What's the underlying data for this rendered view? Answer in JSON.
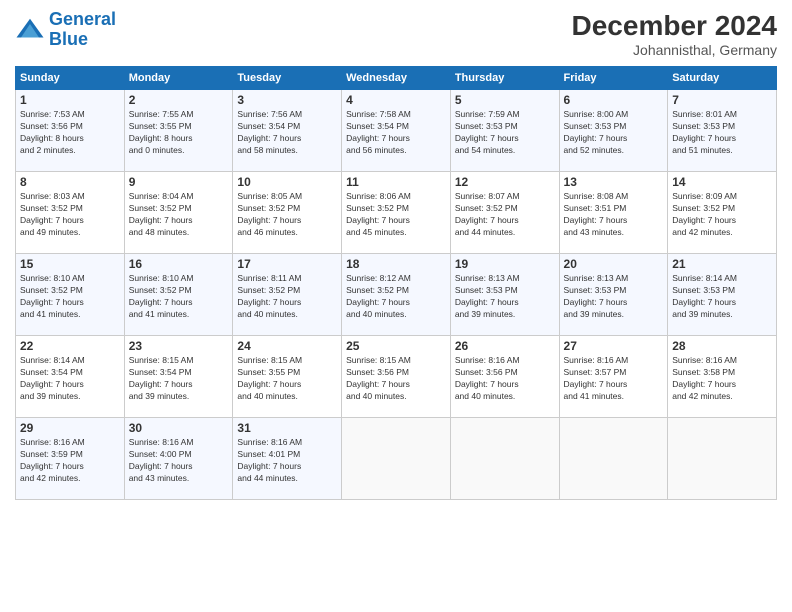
{
  "logo": {
    "line1": "General",
    "line2": "Blue"
  },
  "header": {
    "title": "December 2024",
    "subtitle": "Johannisthal, Germany"
  },
  "weekdays": [
    "Sunday",
    "Monday",
    "Tuesday",
    "Wednesday",
    "Thursday",
    "Friday",
    "Saturday"
  ],
  "weeks": [
    [
      {
        "day": 1,
        "sunrise": "7:53 AM",
        "sunset": "3:56 PM",
        "daylight": "8 hours and 2 minutes."
      },
      {
        "day": 2,
        "sunrise": "7:55 AM",
        "sunset": "3:55 PM",
        "daylight": "8 hours and 0 minutes."
      },
      {
        "day": 3,
        "sunrise": "7:56 AM",
        "sunset": "3:54 PM",
        "daylight": "7 hours and 58 minutes."
      },
      {
        "day": 4,
        "sunrise": "7:58 AM",
        "sunset": "3:54 PM",
        "daylight": "7 hours and 56 minutes."
      },
      {
        "day": 5,
        "sunrise": "7:59 AM",
        "sunset": "3:53 PM",
        "daylight": "7 hours and 54 minutes."
      },
      {
        "day": 6,
        "sunrise": "8:00 AM",
        "sunset": "3:53 PM",
        "daylight": "7 hours and 52 minutes."
      },
      {
        "day": 7,
        "sunrise": "8:01 AM",
        "sunset": "3:53 PM",
        "daylight": "7 hours and 51 minutes."
      }
    ],
    [
      {
        "day": 8,
        "sunrise": "8:03 AM",
        "sunset": "3:52 PM",
        "daylight": "7 hours and 49 minutes."
      },
      {
        "day": 9,
        "sunrise": "8:04 AM",
        "sunset": "3:52 PM",
        "daylight": "7 hours and 48 minutes."
      },
      {
        "day": 10,
        "sunrise": "8:05 AM",
        "sunset": "3:52 PM",
        "daylight": "7 hours and 46 minutes."
      },
      {
        "day": 11,
        "sunrise": "8:06 AM",
        "sunset": "3:52 PM",
        "daylight": "7 hours and 45 minutes."
      },
      {
        "day": 12,
        "sunrise": "8:07 AM",
        "sunset": "3:52 PM",
        "daylight": "7 hours and 44 minutes."
      },
      {
        "day": 13,
        "sunrise": "8:08 AM",
        "sunset": "3:51 PM",
        "daylight": "7 hours and 43 minutes."
      },
      {
        "day": 14,
        "sunrise": "8:09 AM",
        "sunset": "3:52 PM",
        "daylight": "7 hours and 42 minutes."
      }
    ],
    [
      {
        "day": 15,
        "sunrise": "8:10 AM",
        "sunset": "3:52 PM",
        "daylight": "7 hours and 41 minutes."
      },
      {
        "day": 16,
        "sunrise": "8:10 AM",
        "sunset": "3:52 PM",
        "daylight": "7 hours and 41 minutes."
      },
      {
        "day": 17,
        "sunrise": "8:11 AM",
        "sunset": "3:52 PM",
        "daylight": "7 hours and 40 minutes."
      },
      {
        "day": 18,
        "sunrise": "8:12 AM",
        "sunset": "3:52 PM",
        "daylight": "7 hours and 40 minutes."
      },
      {
        "day": 19,
        "sunrise": "8:13 AM",
        "sunset": "3:53 PM",
        "daylight": "7 hours and 39 minutes."
      },
      {
        "day": 20,
        "sunrise": "8:13 AM",
        "sunset": "3:53 PM",
        "daylight": "7 hours and 39 minutes."
      },
      {
        "day": 21,
        "sunrise": "8:14 AM",
        "sunset": "3:53 PM",
        "daylight": "7 hours and 39 minutes."
      }
    ],
    [
      {
        "day": 22,
        "sunrise": "8:14 AM",
        "sunset": "3:54 PM",
        "daylight": "7 hours and 39 minutes."
      },
      {
        "day": 23,
        "sunrise": "8:15 AM",
        "sunset": "3:54 PM",
        "daylight": "7 hours and 39 minutes."
      },
      {
        "day": 24,
        "sunrise": "8:15 AM",
        "sunset": "3:55 PM",
        "daylight": "7 hours and 40 minutes."
      },
      {
        "day": 25,
        "sunrise": "8:15 AM",
        "sunset": "3:56 PM",
        "daylight": "7 hours and 40 minutes."
      },
      {
        "day": 26,
        "sunrise": "8:16 AM",
        "sunset": "3:56 PM",
        "daylight": "7 hours and 40 minutes."
      },
      {
        "day": 27,
        "sunrise": "8:16 AM",
        "sunset": "3:57 PM",
        "daylight": "7 hours and 41 minutes."
      },
      {
        "day": 28,
        "sunrise": "8:16 AM",
        "sunset": "3:58 PM",
        "daylight": "7 hours and 42 minutes."
      }
    ],
    [
      {
        "day": 29,
        "sunrise": "8:16 AM",
        "sunset": "3:59 PM",
        "daylight": "7 hours and 42 minutes."
      },
      {
        "day": 30,
        "sunrise": "8:16 AM",
        "sunset": "4:00 PM",
        "daylight": "7 hours and 43 minutes."
      },
      {
        "day": 31,
        "sunrise": "8:16 AM",
        "sunset": "4:01 PM",
        "daylight": "7 hours and 44 minutes."
      },
      null,
      null,
      null,
      null
    ]
  ]
}
